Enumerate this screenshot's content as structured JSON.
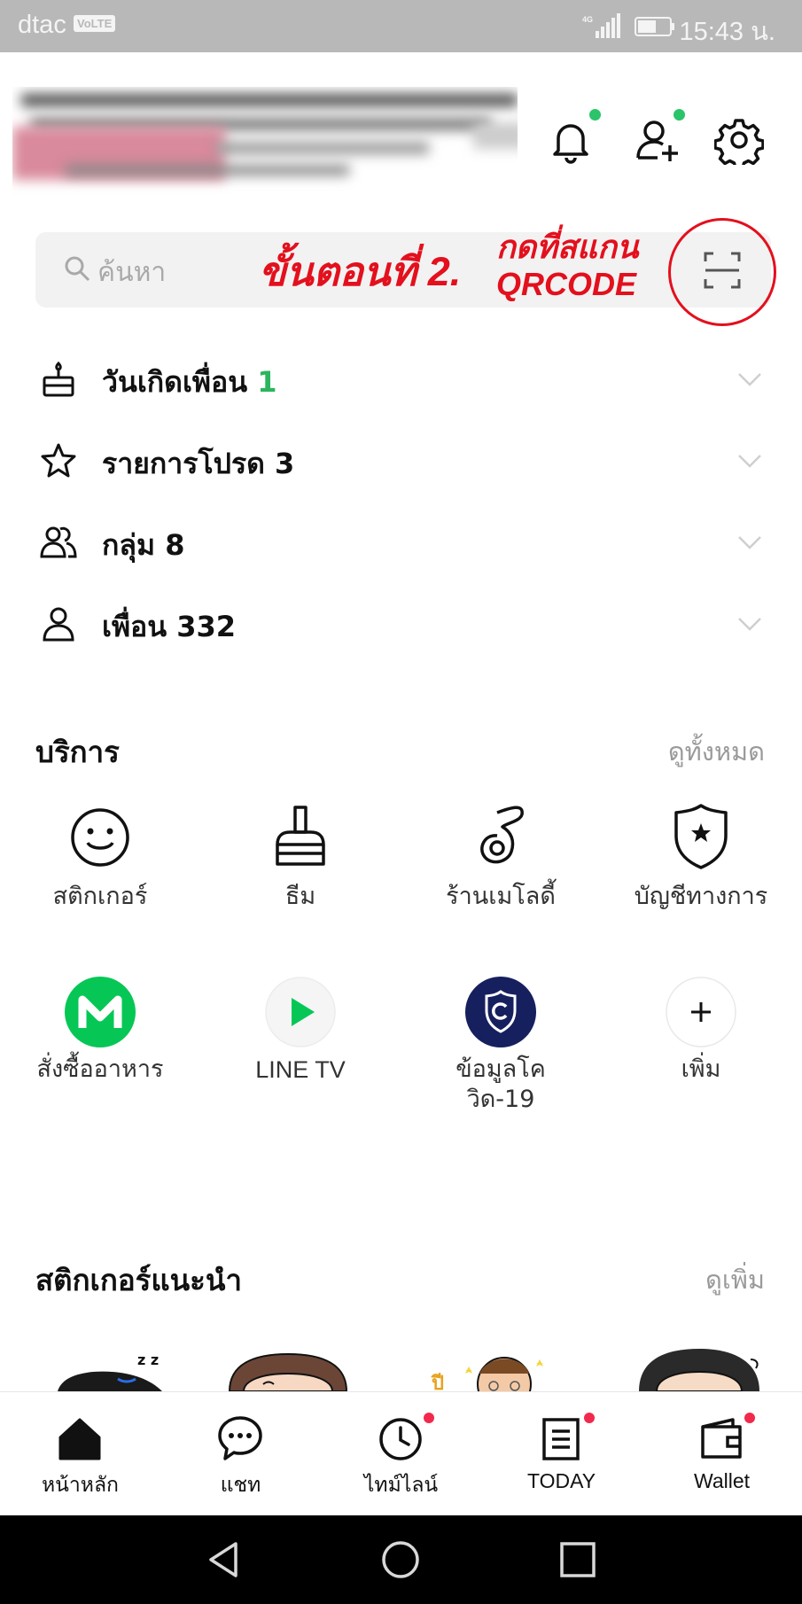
{
  "status_bar": {
    "carrier": "dtac",
    "volte": "VoLTE",
    "network": "4G",
    "time": "15:43 น."
  },
  "header": {
    "profile_name": "",
    "notification_has_badge": true,
    "add_friend_has_badge": true
  },
  "search": {
    "placeholder": "ค้นหา"
  },
  "annotation": {
    "step": "ขั้นตอนที่ 2.",
    "line1": "กดที่สแกน",
    "line2": "QRCODE"
  },
  "lists": [
    {
      "label": "วันเกิดเพื่อน",
      "count": "1",
      "icon": "cake-icon"
    },
    {
      "label": "รายการโปรด",
      "count": "3",
      "icon": "star-icon"
    },
    {
      "label": "กลุ่ม",
      "count": "8",
      "icon": "group-icon"
    },
    {
      "label": "เพื่อน",
      "count": "332",
      "icon": "person-icon"
    }
  ],
  "services": {
    "title": "บริการ",
    "see_all": "ดูทั้งหมด",
    "items": [
      {
        "label": "สติกเกอร์",
        "icon": "smiley-icon"
      },
      {
        "label": "ธีม",
        "icon": "brush-icon"
      },
      {
        "label": "ร้านเมโลดี้",
        "icon": "music-note-icon"
      },
      {
        "label": "บัญชีทางการ",
        "icon": "official-shield-icon"
      },
      {
        "label": "สั่งซื้ออาหาร",
        "icon": "lineman-icon"
      },
      {
        "label": "LINE TV",
        "icon": "play-icon"
      },
      {
        "label_line1": "ข้อมูลโค",
        "label_line2": "วิด-19",
        "icon": "covid-shield-icon"
      },
      {
        "label": "เพิ่ม",
        "icon": "plus-icon"
      }
    ]
  },
  "stickers": {
    "title": "สติกเกอร์แนะนำ",
    "see_more": "ดูเพิ่ม"
  },
  "bottom_nav": [
    {
      "label": "หน้าหลัก",
      "icon": "home-icon",
      "badge": false
    },
    {
      "label": "แชท",
      "icon": "chat-icon",
      "badge": false
    },
    {
      "label": "ไทม์ไลน์",
      "icon": "clock-icon",
      "badge": true
    },
    {
      "label": "TODAY",
      "icon": "news-icon",
      "badge": true
    },
    {
      "label": "Wallet",
      "icon": "wallet-icon",
      "badge": true
    }
  ],
  "colors": {
    "green": "#2bc46a",
    "red_badge": "#f2294c",
    "annotation_red": "#e3101d",
    "lineman_green": "#06c755",
    "covid_navy": "#16205e"
  }
}
